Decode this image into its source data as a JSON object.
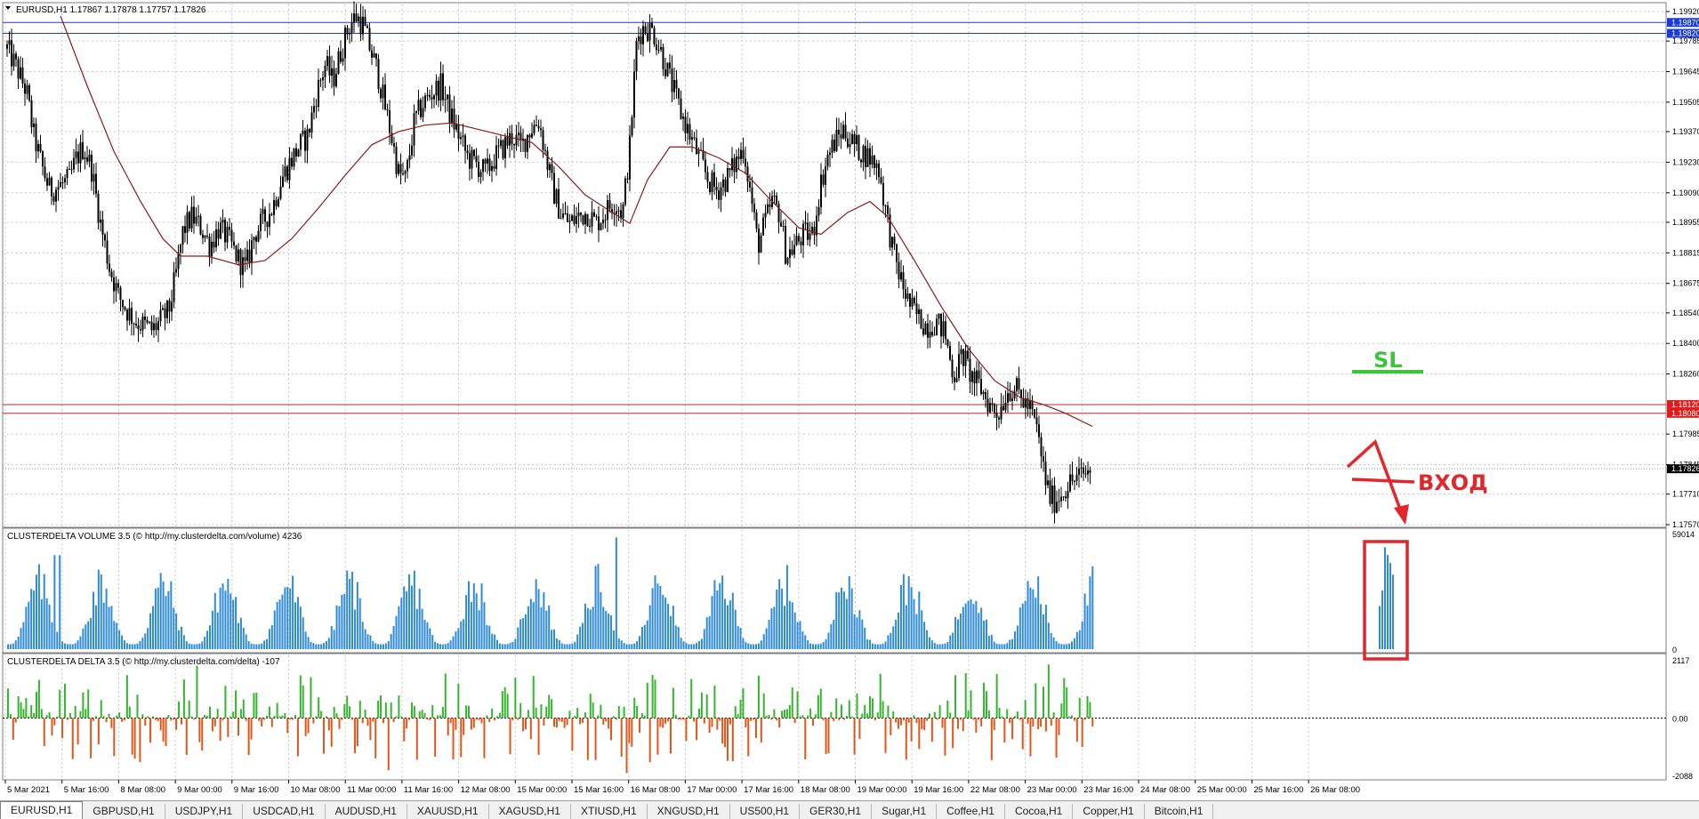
{
  "window": {
    "symbol_header": "EURUSD,H1  1.17867 1.17878 1.17757 1.17826",
    "volume_indicator": "CLUSTERDELTA VOLUME 3.5 (© http://my.clusterdelta.com/volume) 4236",
    "delta_indicator": "CLUSTERDELTA DELTA 3.5 (© http://my.clusterdelta.com/delta) -107"
  },
  "colors": {
    "bull_candle": "#000000",
    "moving_average": "#8b1a1a",
    "blue_levels": "#1f3fb5",
    "red_levels": "#c0282d",
    "volume_bars": "#2f8ad7",
    "delta_positive": "#35b42e",
    "delta_negative": "#e0561b",
    "annotation_green": "#3cc43a",
    "annotation_red": "#e0272c",
    "label_blue_bg": "#1a3bd6",
    "label_red_bg": "#e01b1b"
  },
  "annotations": {
    "sl": "SL",
    "entry": "ВХОД"
  },
  "chart_data": [
    {
      "type": "candlestick",
      "symbol": "EURUSD",
      "timeframe": "H1",
      "ylim": [
        1.1757,
        1.1992
      ],
      "y_ticks": [
        "1.19920",
        "1.19785",
        "1.19645",
        "1.19505",
        "1.19370",
        "1.19230",
        "1.19090",
        "1.18955",
        "1.18815",
        "1.18675",
        "1.18540",
        "1.18400",
        "1.18260",
        "1.17985",
        "1.17845",
        "1.17710",
        "1.17570"
      ],
      "price_labels": [
        {
          "text": "1.19870",
          "value": 1.1987,
          "color": "blue"
        },
        {
          "text": "1.19820",
          "value": 1.1982,
          "color": "blue"
        },
        {
          "text": "1.18120",
          "value": 1.1812,
          "color": "red"
        },
        {
          "text": "1.18080",
          "value": 1.1808,
          "color": "red"
        },
        {
          "text": "1.17826",
          "value": 1.17826,
          "color": "black"
        }
      ],
      "horizontal_levels": [
        1.1987,
        1.1982,
        1.1812,
        1.1808
      ],
      "close_path": [
        [
          0,
          1.1975
        ],
        [
          12,
          1.1965
        ],
        [
          22,
          1.1955
        ],
        [
          30,
          1.1935
        ],
        [
          40,
          1.192
        ],
        [
          48,
          1.191
        ],
        [
          58,
          1.1912
        ],
        [
          70,
          1.1915
        ],
        [
          78,
          1.1925
        ],
        [
          86,
          1.193
        ],
        [
          95,
          1.192
        ],
        [
          105,
          1.1895
        ],
        [
          115,
          1.1875
        ],
        [
          125,
          1.1862
        ],
        [
          135,
          1.1855
        ],
        [
          145,
          1.185
        ],
        [
          155,
          1.1848
        ],
        [
          163,
          1.1846
        ],
        [
          172,
          1.185
        ],
        [
          182,
          1.1855
        ],
        [
          190,
          1.1872
        ],
        [
          198,
          1.1892
        ],
        [
          208,
          1.1898
        ],
        [
          218,
          1.1893
        ],
        [
          228,
          1.1885
        ],
        [
          238,
          1.1893
        ],
        [
          248,
          1.1888
        ],
        [
          258,
          1.188
        ],
        [
          268,
          1.1874
        ],
        [
          278,
          1.189
        ],
        [
          288,
          1.1896
        ],
        [
          298,
          1.1902
        ],
        [
          308,
          1.1915
        ],
        [
          318,
          1.1923
        ],
        [
          328,
          1.193
        ],
        [
          338,
          1.1935
        ],
        [
          348,
          1.1955
        ],
        [
          358,
          1.1968
        ],
        [
          366,
          1.196
        ],
        [
          374,
          1.1972
        ],
        [
          384,
          1.1985
        ],
        [
          392,
          1.199
        ],
        [
          400,
          1.1986
        ],
        [
          408,
          1.1975
        ],
        [
          416,
          1.1965
        ],
        [
          424,
          1.195
        ],
        [
          432,
          1.1935
        ],
        [
          440,
          1.1918
        ],
        [
          448,
          1.1915
        ],
        [
          458,
          1.1942
        ],
        [
          468,
          1.195
        ],
        [
          478,
          1.1955
        ],
        [
          488,
          1.1958
        ],
        [
          498,
          1.1945
        ],
        [
          508,
          1.1935
        ],
        [
          518,
          1.1925
        ],
        [
          528,
          1.1922
        ],
        [
          538,
          1.1918
        ],
        [
          548,
          1.1925
        ],
        [
          558,
          1.193
        ],
        [
          568,
          1.1935
        ],
        [
          578,
          1.193
        ],
        [
          588,
          1.1938
        ],
        [
          598,
          1.1942
        ],
        [
          606,
          1.1925
        ],
        [
          614,
          1.191
        ],
        [
          622,
          1.19
        ],
        [
          632,
          1.1895
        ],
        [
          642,
          1.1898
        ],
        [
          652,
          1.19
        ],
        [
          662,
          1.1895
        ],
        [
          672,
          1.19
        ],
        [
          682,
          1.1905
        ],
        [
          692,
          1.19
        ],
        [
          700,
          1.193
        ],
        [
          708,
          1.198
        ],
        [
          716,
          1.1985
        ],
        [
          726,
          1.1983
        ],
        [
          734,
          1.1975
        ],
        [
          742,
          1.1965
        ],
        [
          750,
          1.1955
        ],
        [
          758,
          1.1945
        ],
        [
          768,
          1.1935
        ],
        [
          778,
          1.1925
        ],
        [
          788,
          1.1915
        ],
        [
          798,
          1.191
        ],
        [
          808,
          1.1915
        ],
        [
          818,
          1.1922
        ],
        [
          828,
          1.193
        ],
        [
          836,
          1.1908
        ],
        [
          844,
          1.1885
        ],
        [
          852,
          1.1895
        ],
        [
          860,
          1.1905
        ],
        [
          868,
          1.19
        ],
        [
          876,
          1.188
        ],
        [
          886,
          1.1885
        ],
        [
          896,
          1.189
        ],
        [
          906,
          1.189
        ],
        [
          914,
          1.1912
        ],
        [
          922,
          1.1925
        ],
        [
          930,
          1.1932
        ],
        [
          940,
          1.1938
        ],
        [
          950,
          1.1932
        ],
        [
          960,
          1.1928
        ],
        [
          970,
          1.1925
        ],
        [
          980,
          1.192
        ],
        [
          988,
          1.19
        ],
        [
          996,
          1.1882
        ],
        [
          1004,
          1.187
        ],
        [
          1014,
          1.1858
        ],
        [
          1024,
          1.1852
        ],
        [
          1034,
          1.1848
        ],
        [
          1044,
          1.185
        ],
        [
          1054,
          1.1845
        ],
        [
          1064,
          1.1825
        ],
        [
          1074,
          1.1835
        ],
        [
          1084,
          1.1825
        ],
        [
          1094,
          1.182
        ],
        [
          1104,
          1.1812
        ],
        [
          1114,
          1.1808
        ],
        [
          1124,
          1.1818
        ],
        [
          1132,
          1.182
        ],
        [
          1140,
          1.1815
        ],
        [
          1150,
          1.181
        ],
        [
          1158,
          1.18
        ],
        [
          1166,
          1.178
        ],
        [
          1172,
          1.177
        ],
        [
          1178,
          1.1768
        ],
        [
          1186,
          1.1772
        ],
        [
          1194,
          1.1776
        ],
        [
          1202,
          1.1778
        ],
        [
          1210,
          1.178
        ],
        [
          1218,
          1.1782
        ]
      ],
      "ma_path": [
        [
          60,
          1.199
        ],
        [
          90,
          1.1958
        ],
        [
          120,
          1.1928
        ],
        [
          150,
          1.1905
        ],
        [
          175,
          1.1888
        ],
        [
          195,
          1.188
        ],
        [
          225,
          1.188
        ],
        [
          260,
          1.1876
        ],
        [
          290,
          1.1878
        ],
        [
          320,
          1.1888
        ],
        [
          350,
          1.1902
        ],
        [
          380,
          1.1917
        ],
        [
          410,
          1.1931
        ],
        [
          440,
          1.1937
        ],
        [
          470,
          1.194
        ],
        [
          500,
          1.1941
        ],
        [
          530,
          1.1938
        ],
        [
          560,
          1.1935
        ],
        [
          590,
          1.1932
        ],
        [
          620,
          1.1921
        ],
        [
          650,
          1.1908
        ],
        [
          680,
          1.19
        ],
        [
          700,
          1.1895
        ],
        [
          720,
          1.1915
        ],
        [
          745,
          1.193
        ],
        [
          770,
          1.193
        ],
        [
          800,
          1.1925
        ],
        [
          830,
          1.1918
        ],
        [
          860,
          1.1905
        ],
        [
          890,
          1.1893
        ],
        [
          915,
          1.189
        ],
        [
          945,
          1.19
        ],
        [
          970,
          1.1905
        ],
        [
          990,
          1.1898
        ],
        [
          1020,
          1.1878
        ],
        [
          1050,
          1.1857
        ],
        [
          1080,
          1.1838
        ],
        [
          1110,
          1.1823
        ],
        [
          1140,
          1.1815
        ],
        [
          1165,
          1.1812
        ],
        [
          1190,
          1.1808
        ],
        [
          1220,
          1.1802
        ]
      ]
    },
    {
      "type": "bar",
      "title": "CLUSTERDELTA VOLUME 3.5",
      "ylim": [
        0,
        59014
      ],
      "y_ticks": [
        "59014",
        "0"
      ]
    },
    {
      "type": "bar",
      "title": "CLUSTERDELTA DELTA 3.5",
      "ylim": [
        -2088,
        2117
      ],
      "y_ticks": [
        "2117",
        "0.00",
        "-2088"
      ]
    }
  ],
  "x_labels": [
    "5 Mar 2021",
    "5 Mar 16:00",
    "8 Mar 08:00",
    "9 Mar 00:00",
    "9 Mar 16:00",
    "10 Mar 08:00",
    "11 Mar 00:00",
    "11 Mar 16:00",
    "12 Mar 08:00",
    "15 Mar 00:00",
    "15 Mar 16:00",
    "16 Mar 08:00",
    "17 Mar 00:00",
    "17 Mar 16:00",
    "18 Mar 08:00",
    "19 Mar 00:00",
    "19 Mar 16:00",
    "22 Mar 08:00",
    "23 Mar 00:00",
    "23 Mar 16:00",
    "24 Mar 08:00",
    "25 Mar 00:00",
    "25 Mar 16:00",
    "26 Mar 08:00"
  ],
  "tabs": [
    "EURUSD,H1",
    "GBPUSD,H1",
    "USDJPY,H1",
    "USDCAD,H1",
    "AUDUSD,H1",
    "XAUUSD,H1",
    "XAGUSD,H1",
    "XTIUSD,H1",
    "XNGUSD,H1",
    "US500,H1",
    "GER30,H1",
    "Sugar,H1",
    "Coffee,H1",
    "Cocoa,H1",
    "Copper,H1",
    "Bitcoin,H1"
  ]
}
